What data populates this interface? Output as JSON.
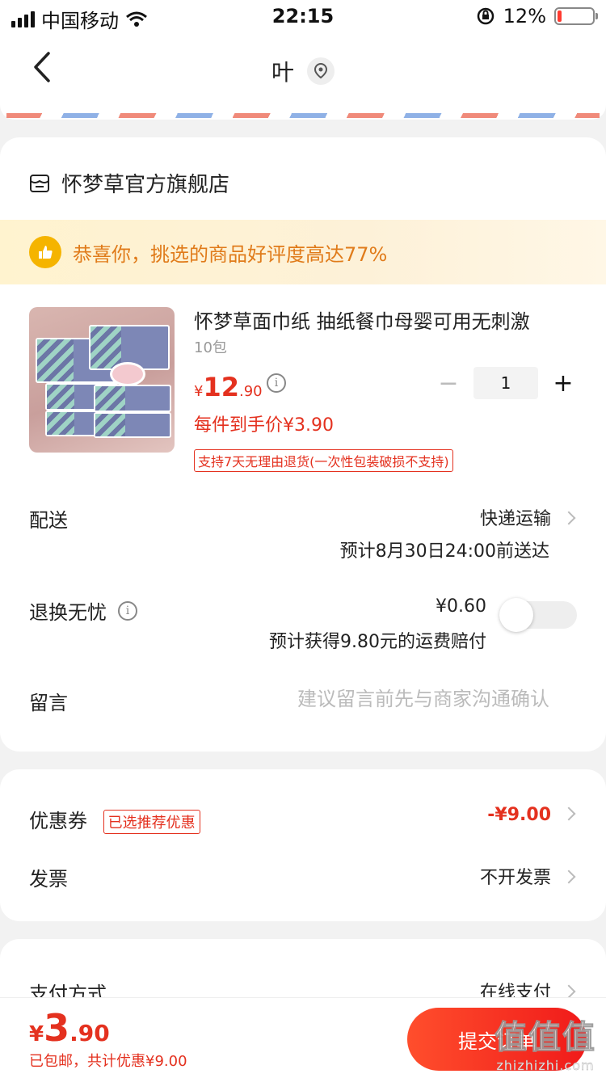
{
  "status_bar": {
    "carrier": "中国移动",
    "time": "22:15",
    "battery_percent": "12%",
    "battery_level": 0.12
  },
  "nav": {
    "title": "叶",
    "icons": [
      "back-icon",
      "location-pin-icon"
    ]
  },
  "store": {
    "name": "怀梦草官方旗舰店",
    "promo": "恭喜你，挑选的商品好评度高达77%"
  },
  "product": {
    "title": "怀梦草面巾纸 抽纸餐巾母婴可用无刺激",
    "spec": "10包",
    "price_yen": "¥",
    "price_int": "12",
    "price_dec": ".90",
    "info_icon": "i",
    "quantity": "1",
    "unit_price_label": "每件到手价¥3.90",
    "return_tag": "支持7天无理由退货(一次性包装破损不支持)"
  },
  "delivery": {
    "label": "配送",
    "method": "快递运输",
    "estimate": "预计8月30日24:00前送达"
  },
  "return_insurance": {
    "label": "退换无忧",
    "price": "¥0.60",
    "desc": "预计获得9.80元的运费赔付",
    "enabled": false
  },
  "message": {
    "label": "留言",
    "placeholder": "建议留言前先与商家沟通确认"
  },
  "coupon": {
    "label": "优惠券",
    "tag": "已选推荐优惠",
    "value": "-¥9.00"
  },
  "invoice": {
    "label": "发票",
    "value": "不开发票"
  },
  "payment": {
    "label": "支付方式",
    "value": "在线支付"
  },
  "footer": {
    "total_yen": "¥",
    "total_int": "3",
    "total_dec": ".90",
    "summary": "已包邮，共计优惠¥9.00",
    "submit_label": "提交订单"
  },
  "watermark": {
    "logo": "值值值",
    "url": "zhizhizhi.com"
  },
  "colors": {
    "accent": "#e4311f",
    "promo_text": "#e07b1a",
    "promo_bg": "#fff3cf"
  }
}
